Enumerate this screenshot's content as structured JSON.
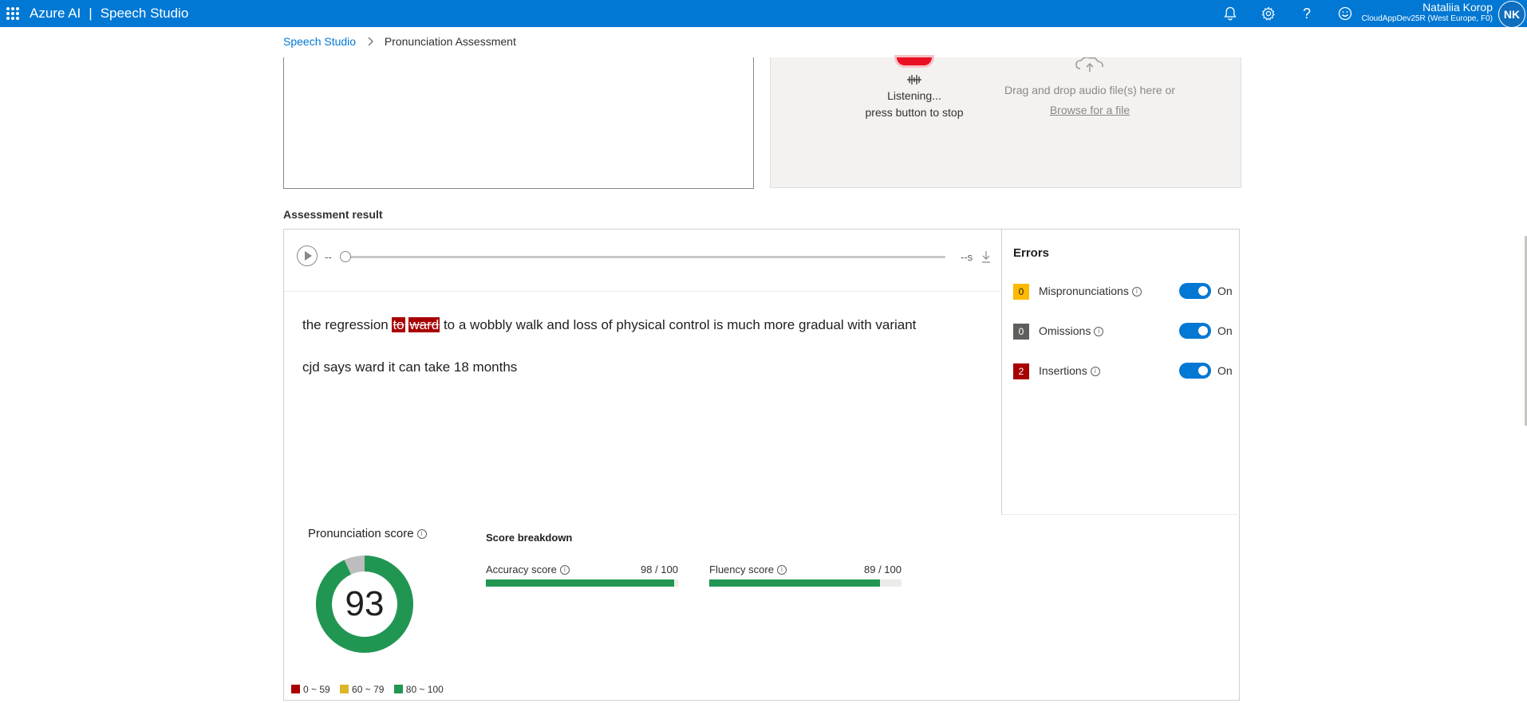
{
  "header": {
    "brand": "Azure AI",
    "product": "Speech Studio",
    "user_name": "Nataliia Korop",
    "tenant": "CloudAppDev25R (West Europe, F0)",
    "avatar_initials": "NK"
  },
  "breadcrumb": {
    "home": "Speech Studio",
    "current": "Pronunciation Assessment"
  },
  "recorder": {
    "status_line1": "Listening...",
    "status_line2": "press button to stop",
    "drop_text": "Drag and drop audio file(s) here or",
    "browse_link": "Browse for a file"
  },
  "result": {
    "section_title": "Assessment result",
    "player": {
      "time_left": "--",
      "time_right": "--s"
    },
    "transcript": {
      "line1_before": "the regression ",
      "ins1": "to",
      "ins2": "ward",
      "line1_after": " to a wobbly walk and loss of physical control is much more gradual with variant",
      "line2": "cjd says ward it can take 18 months"
    },
    "errors": {
      "title": "Errors",
      "items": [
        {
          "label": "Mispronunciations",
          "count": "0",
          "color": "#ffb900",
          "toggle": "On"
        },
        {
          "label": "Omissions",
          "count": "0",
          "color": "#605e5c",
          "toggle": "On"
        },
        {
          "label": "Insertions",
          "count": "2",
          "color": "#a80000",
          "toggle": "On"
        }
      ]
    },
    "score": {
      "title": "Pronunciation score",
      "value": "93",
      "value_fraction": 0.93,
      "legend": [
        {
          "label": "0 ~ 59",
          "color": "#a80000"
        },
        {
          "label": "60 ~ 79",
          "color": "#d9b728"
        },
        {
          "label": "80 ~ 100",
          "color": "#219653"
        }
      ]
    },
    "breakdown": {
      "title": "Score breakdown",
      "accuracy": {
        "label": "Accuracy score",
        "value": "98 / 100",
        "fraction": 0.98
      },
      "fluency": {
        "label": "Fluency score",
        "value": "89 / 100",
        "fraction": 0.89
      }
    }
  },
  "colors": {
    "brand_blue": "#0078d4",
    "score_green": "#219653",
    "insertion_red": "#a80000"
  }
}
